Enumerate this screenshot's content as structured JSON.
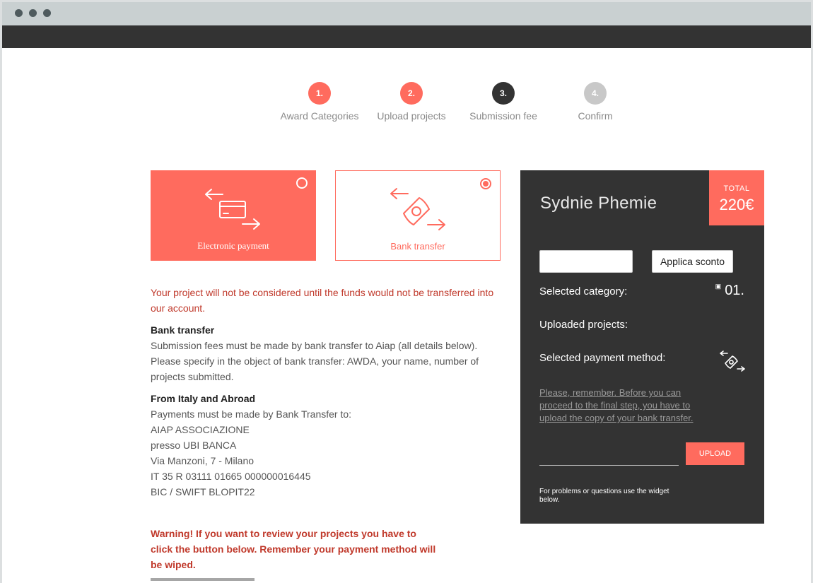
{
  "steps": [
    {
      "num": "1.",
      "label": "Award Categories",
      "color": "#ff6b5e"
    },
    {
      "num": "2.",
      "label": "Upload projects",
      "color": "#ff6b5e"
    },
    {
      "num": "3.",
      "label": "Submission fee",
      "color": "#333333"
    },
    {
      "num": "4.",
      "label": "Confirm",
      "color": "#c8c8c8"
    }
  ],
  "payment_options": {
    "electronic": {
      "label": "Electronic payment",
      "selected": false,
      "icon": "credit-card-icon"
    },
    "bank": {
      "label": "Bank transfer",
      "selected": true,
      "icon": "bank-transfer-icon"
    }
  },
  "content": {
    "notice": "Your project will not be considered until the funds would not be transferred into our account.",
    "bank_heading": "Bank transfer",
    "bank_line1": "Submission fees must be made by bank transfer to Aiap (all details below).",
    "bank_line2": "Please specify in the object of bank transfer: AWDA, your name, number of projects submitted.",
    "from_heading": "From Italy and Abroad",
    "details": [
      "Payments must be made by Bank Transfer to:",
      "AIAP ASSOCIAZIONE",
      "presso UBI BANCA",
      "Via Manzoni, 7 - Milano",
      "IT 35 R 03111 01665 000000016445",
      "BIC / SWIFT BLOPIT22"
    ],
    "warning": "Warning! If you want to review your projects you have to click the button below. Remember your payment method will be wiped."
  },
  "panel": {
    "name": "Sydnie Phemie",
    "total_label": "TOTAL",
    "total_value": "220€",
    "discount_value": "",
    "discount_button": "Applica sconto",
    "selected_category_label": "Selected category:",
    "selected_category_value": "01.",
    "uploaded_projects_label": "Uploaded projects:",
    "payment_method_label": "Selected payment method:",
    "remember": "Please, remember. Before you can proceed to the final step, you have to upload the copy of your bank transfer.",
    "upload_button": "UPLOAD",
    "problems": "For problems or questions use the widget below."
  },
  "colors": {
    "accent": "#ff6b5e",
    "dark": "#333333",
    "warning": "#c0392b"
  }
}
